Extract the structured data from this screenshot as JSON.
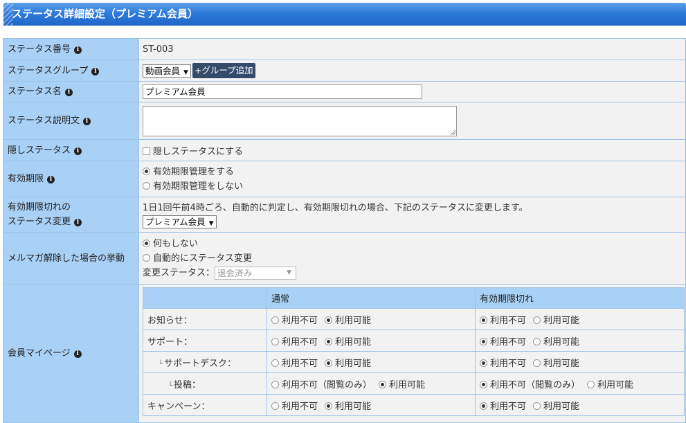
{
  "header": {
    "title": "ステータス詳細設定（プレミアム会員）"
  },
  "rows": {
    "status_number": {
      "label": "ステータス番号",
      "value": "ST-003"
    },
    "status_group": {
      "label": "ステータスグループ",
      "selected": "動画会員",
      "add_button": "+グループ追加"
    },
    "status_name": {
      "label": "ステータス名",
      "value": "プレミアム会員"
    },
    "status_description": {
      "label": "ステータス説明文",
      "value": ""
    },
    "hidden_status": {
      "label": "隠しステータス",
      "checkbox_label": "隠しステータスにする",
      "checked": false
    },
    "expiration": {
      "label": "有効期限",
      "options": [
        "有効期限管理をする",
        "有効期限管理をしない"
      ],
      "selected": 0
    },
    "expired_change": {
      "label_line1": "有効期限切れの",
      "label_line2": "ステータス変更",
      "description": "1日1回午前4時ごろ、自動的に判定し、有効期限切れの場合、下記のステータスに変更します。",
      "selected": "プレミアム会員"
    },
    "mailmag_unsubscribe": {
      "label": "メルマガ解除した場合の挙動",
      "options": [
        "何もしない",
        "自動的にステータス変更"
      ],
      "selected": 0,
      "change_status_label": "変更ステータス：",
      "change_status_value": "退会済み"
    },
    "member_mypage": {
      "label": "会員マイページ",
      "columns": [
        "",
        "通常",
        "有効期限切れ"
      ],
      "items": [
        {
          "name": "お知らせ：",
          "normal": [
            "利用不可",
            "利用可能"
          ],
          "normal_sel": 1,
          "expired": [
            "利用不可",
            "利用可能"
          ],
          "expired_sel": 0
        },
        {
          "name": "サポート：",
          "normal": [
            "利用不可",
            "利用可能"
          ],
          "normal_sel": 1,
          "expired": [
            "利用不可",
            "利用可能"
          ],
          "expired_sel": 0
        },
        {
          "name": "サポートデスク：",
          "normal": [
            "利用不可",
            "利用可能"
          ],
          "normal_sel": 1,
          "expired": [
            "利用不可",
            "利用可能"
          ],
          "expired_sel": 0
        },
        {
          "name": "投稿：",
          "normal": [
            "利用不可（閲覧のみ）",
            "利用可能"
          ],
          "normal_sel": 1,
          "expired": [
            "利用不可（閲覧のみ）",
            "利用可能"
          ],
          "expired_sel": 0
        },
        {
          "name": "キャンペーン：",
          "normal": [
            "利用不可",
            "利用可能"
          ],
          "normal_sel": 1,
          "expired": [
            "利用不可",
            "利用可能"
          ],
          "expired_sel": 0
        }
      ]
    }
  },
  "icons": {
    "info": "info-icon",
    "dropdown": "caret-down-icon",
    "sub_item": "tree-branch-icon"
  }
}
